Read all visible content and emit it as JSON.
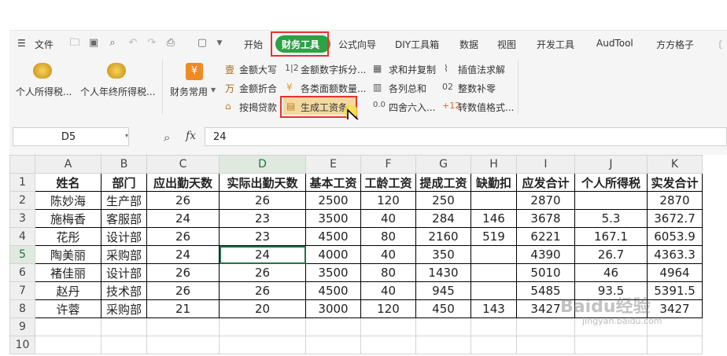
{
  "menubar": {
    "file_label": "文件",
    "tabs": [
      {
        "label": "开始"
      },
      {
        "label": "财务工具"
      },
      {
        "label": "公式向导"
      },
      {
        "label": "DIY工具箱"
      },
      {
        "label": "数据"
      },
      {
        "label": "视图"
      },
      {
        "label": "开发工具"
      },
      {
        "label": "AudTool"
      },
      {
        "label": "方方格子"
      }
    ],
    "active_tab": "财务工具"
  },
  "ribbon": {
    "big_buttons": [
      {
        "label": "个人所得税..."
      },
      {
        "label": "个人年终所得税..."
      },
      {
        "label": "财务常用"
      }
    ],
    "col1": [
      {
        "label": "金额大写"
      },
      {
        "label": "金额折合"
      },
      {
        "label": "按揭贷款"
      }
    ],
    "col2": [
      {
        "label": "金额数字拆分..."
      },
      {
        "label": "各类面额数量..."
      },
      {
        "label": "生成工资条"
      }
    ],
    "col3": [
      {
        "label": "求和并复制"
      },
      {
        "label": "各列总和"
      },
      {
        "label": "四舍六入..."
      }
    ],
    "col4": [
      {
        "label": "插值法求解"
      },
      {
        "label": "整数补零"
      },
      {
        "label": "转数值格式..."
      }
    ]
  },
  "formula_bar": {
    "name_box": "D5",
    "fx_label": "fx",
    "value": "24"
  },
  "sheet": {
    "columns": [
      "A",
      "B",
      "C",
      "D",
      "E",
      "F",
      "G",
      "H",
      "I",
      "J",
      "K"
    ],
    "rows": [
      {
        "num": "1",
        "cells": [
          "姓名",
          "部门",
          "应出勤天数",
          "实际出勤天数",
          "基本工资",
          "工龄工资",
          "提成工资",
          "缺勤扣",
          "应发合计",
          "个人所得税",
          "实发合计"
        ]
      },
      {
        "num": "2",
        "cells": [
          "陈妙海",
          "生产部",
          "26",
          "26",
          "2500",
          "120",
          "250",
          "",
          "2870",
          "",
          "2870"
        ]
      },
      {
        "num": "3",
        "cells": [
          "施梅香",
          "客服部",
          "24",
          "23",
          "3500",
          "40",
          "284",
          "146",
          "3678",
          "5.3",
          "3672.7"
        ]
      },
      {
        "num": "4",
        "cells": [
          "花彤",
          "设计部",
          "26",
          "23",
          "4500",
          "80",
          "2160",
          "519",
          "6221",
          "167.1",
          "6053.9"
        ]
      },
      {
        "num": "5",
        "cells": [
          "陶美丽",
          "采购部",
          "24",
          "24",
          "4000",
          "40",
          "350",
          "",
          "4390",
          "26.7",
          "4363.3"
        ]
      },
      {
        "num": "6",
        "cells": [
          "褚佳丽",
          "设计部",
          "26",
          "26",
          "3500",
          "80",
          "1430",
          "",
          "5010",
          "46",
          "4964"
        ]
      },
      {
        "num": "7",
        "cells": [
          "赵丹",
          "技术部",
          "26",
          "26",
          "4500",
          "40",
          "945",
          "",
          "5485",
          "93.5",
          "5391.5"
        ]
      },
      {
        "num": "8",
        "cells": [
          "许蓉",
          "采购部",
          "21",
          "20",
          "3000",
          "120",
          "450",
          "143",
          "3427",
          "",
          "3427"
        ]
      },
      {
        "num": "9",
        "cells": [
          "",
          "",
          "",
          "",
          "",
          "",
          "",
          "",
          "",
          "",
          ""
        ]
      },
      {
        "num": "10",
        "cells": [
          "",
          "",
          "",
          "",
          "",
          "",
          "",
          "",
          "",
          "",
          ""
        ]
      }
    ],
    "active_cell": "D5"
  },
  "watermark": {
    "text": "Baidu经验",
    "sub": "jingyan.baidu.com"
  },
  "colors": {
    "accent_green": "#2ba245",
    "highlight_red": "#e8322e",
    "select_green": "#217346"
  }
}
